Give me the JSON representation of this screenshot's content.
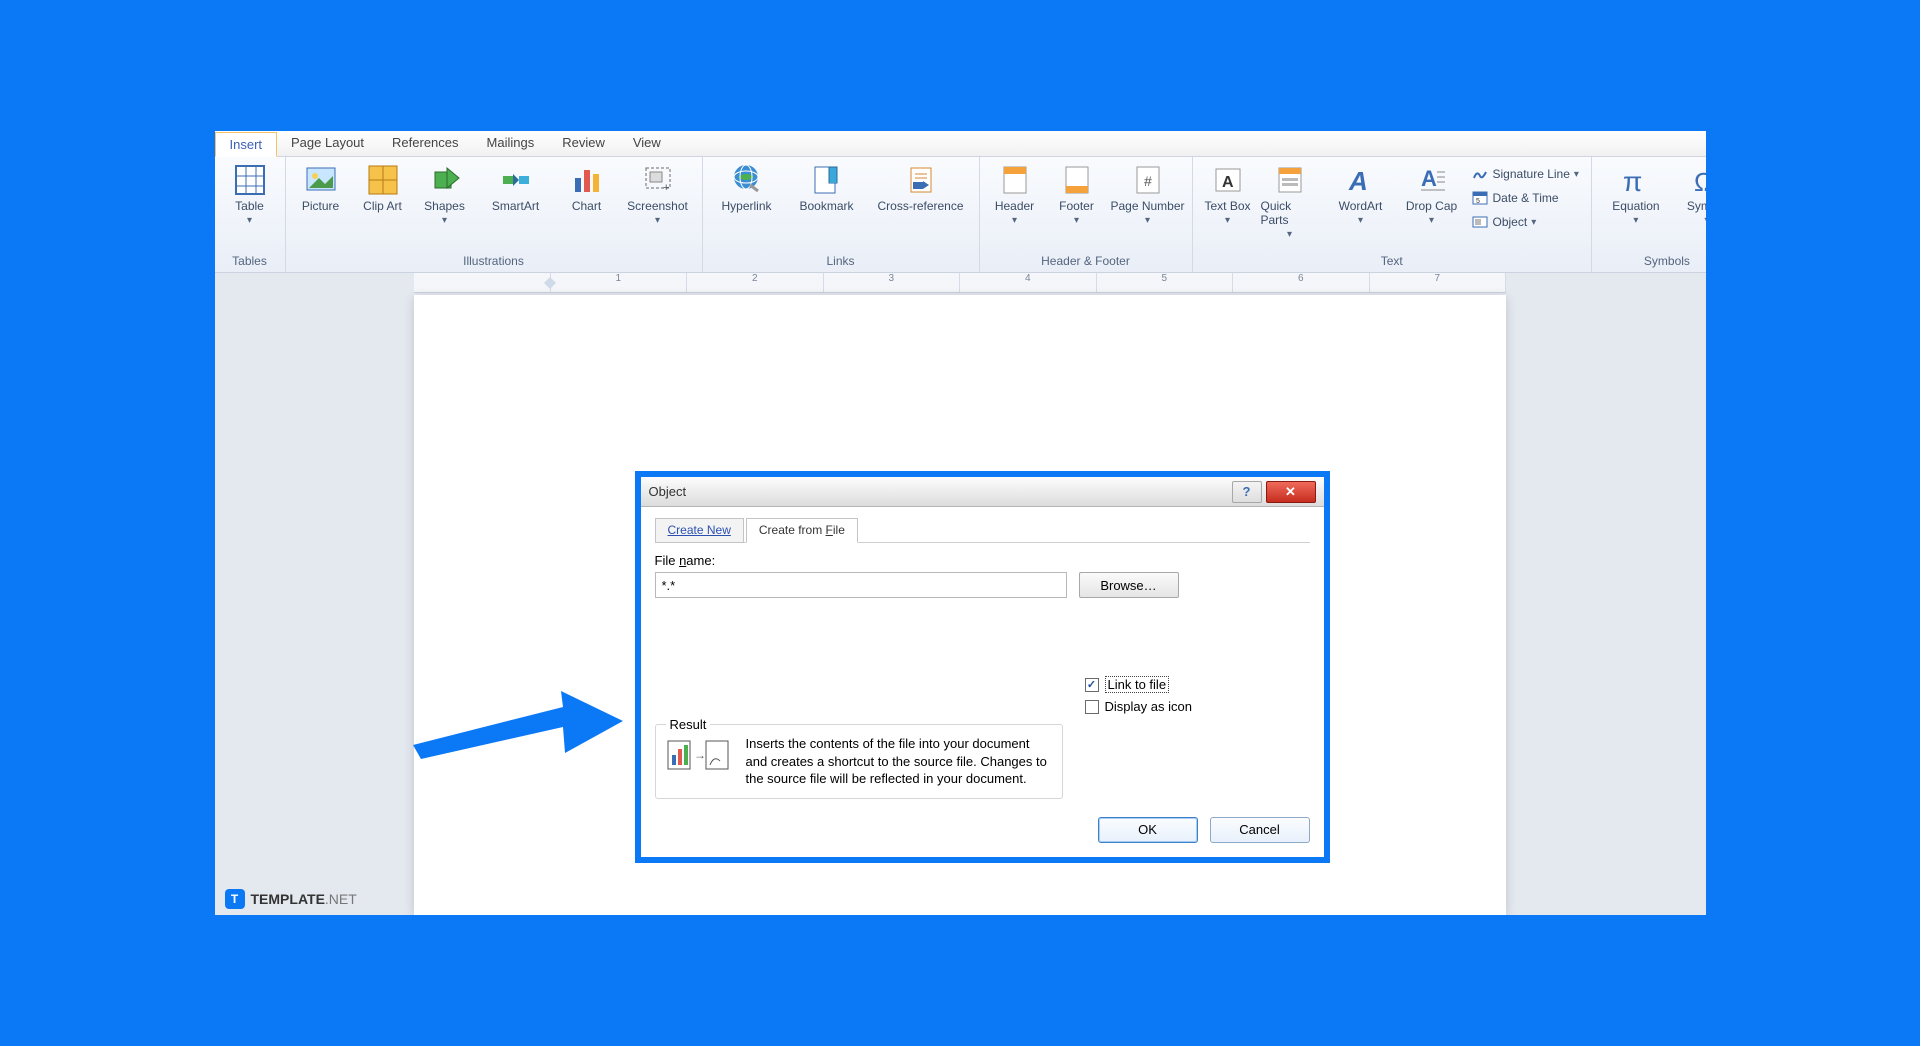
{
  "tabs": {
    "insert": "Insert",
    "page_layout": "Page Layout",
    "references": "References",
    "mailings": "Mailings",
    "review": "Review",
    "view": "View"
  },
  "ribbon": {
    "tables": {
      "label": "Tables",
      "table": "Table"
    },
    "illustrations": {
      "label": "Illustrations",
      "picture": "Picture",
      "clipart": "Clip Art",
      "shapes": "Shapes",
      "smartart": "SmartArt",
      "chart": "Chart",
      "screenshot": "Screenshot"
    },
    "links": {
      "label": "Links",
      "hyperlink": "Hyperlink",
      "bookmark": "Bookmark",
      "crossref": "Cross-reference"
    },
    "headerfooter": {
      "label": "Header & Footer",
      "header": "Header",
      "footer": "Footer",
      "pagenumber": "Page Number"
    },
    "text": {
      "label": "Text",
      "textbox": "Text Box",
      "quickparts": "Quick Parts",
      "wordart": "WordArt",
      "dropcap": "Drop Cap",
      "signature": "Signature Line",
      "datetime": "Date & Time",
      "object": "Object"
    },
    "symbols": {
      "label": "Symbols",
      "equation": "Equation",
      "symbol": "Symbol"
    }
  },
  "ruler_marks": [
    "1",
    "2",
    "3",
    "4",
    "5",
    "6",
    "7"
  ],
  "dialog": {
    "title": "Object",
    "tabs": {
      "create_new": "Create New",
      "create_file": "Create from File"
    },
    "filename_label_pre": "File ",
    "filename_label_un": "n",
    "filename_label_post": "ame:",
    "filename_value": "*.*",
    "browse": "Browse…",
    "linktofile_pre": "Lin",
    "linktofile_un": "k",
    "linktofile_post": " to file",
    "displayicon_pre": "Displ",
    "displayicon_un": "a",
    "displayicon_post": "y as icon",
    "result_legend": "Result",
    "result_text": "Inserts the contents of the file into your document and creates a shortcut to the source file.  Changes to the source file will be reflected in your document.",
    "ok": "OK",
    "cancel": "Cancel"
  },
  "brand": {
    "strong": "TEMPLATE",
    "light": ".NET"
  }
}
